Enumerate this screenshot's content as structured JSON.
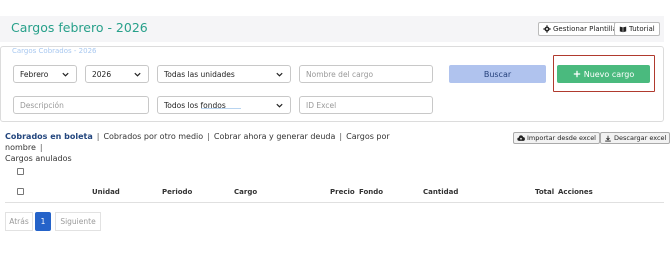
{
  "header": {
    "title": "Cargos febrero - 2026",
    "gestionar_label": "Gestionar Plantillas",
    "tutorial_label": "Tutorial"
  },
  "filters": {
    "ghost_label": "Cargos Cobrados - 2026",
    "month": "Febrero",
    "year": "2026",
    "units": "Todas las unidades",
    "cargo_name_placeholder": "Nombre del cargo",
    "search_label": "Buscar",
    "new_label": "Nuevo cargo",
    "description_placeholder": "Descripción",
    "funds": "Todos los fondos",
    "id_excel_placeholder": "ID Excel"
  },
  "tabs": {
    "boleta": "Cobrados en boleta",
    "otro_medio": "Cobrados por otro medio",
    "cobrar_ahora": "Cobrar ahora y generar deuda",
    "por_nombre": "Cargos por nombre",
    "anulados": "Cargos anulados",
    "separator": "|"
  },
  "actions": {
    "import_label": "Importar desde excel",
    "download_label": "Descargar excel"
  },
  "table": {
    "columns": {
      "unidad": "Unidad",
      "periodo": "Periodo",
      "cargo": "Cargo",
      "precio": "Precio",
      "fondo": "Fondo",
      "cantidad": "Cantidad",
      "total": "Total",
      "acciones": "Acciones"
    }
  },
  "pagination": {
    "prev": "Atrás",
    "current": "1",
    "next": "Siguiente"
  },
  "colors": {
    "title": "#27a08a",
    "primary_button": "#4aba7e",
    "search_button": "#b0c3ee",
    "active_tab": "#23467e",
    "highlight": "#b03a2e",
    "pager_active": "#2563c9"
  }
}
